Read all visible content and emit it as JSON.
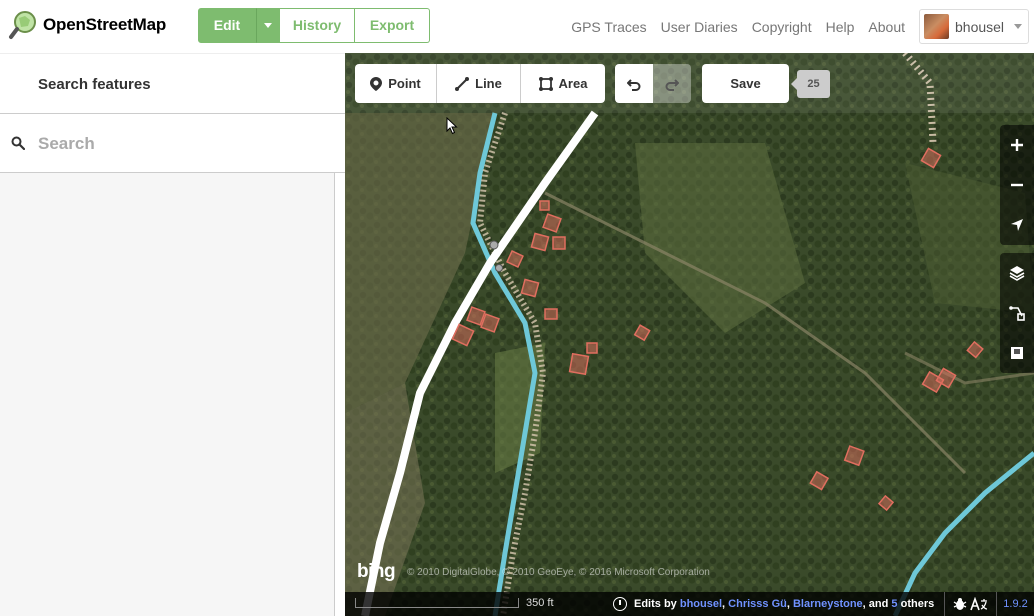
{
  "app": {
    "brand": "OpenStreetMap",
    "edit_label": "Edit",
    "history_label": "History",
    "export_label": "Export"
  },
  "nav": {
    "links": [
      "GPS Traces",
      "User Diaries",
      "Copyright",
      "Help",
      "About"
    ],
    "username": "bhousel"
  },
  "sidebar": {
    "title": "Search features",
    "search_placeholder": "Search"
  },
  "toolbar": {
    "point_label": "Point",
    "line_label": "Line",
    "area_label": "Area",
    "save_label": "Save",
    "edit_count": "25"
  },
  "map": {
    "imagery_logo": "bing",
    "attribution": "© 2010 DigitalGlobe, © 2010 GeoEye, © 2016 Microsoft Corporation",
    "scale_label": "350 ft",
    "footer": {
      "edits_by": "Edits by",
      "users": [
        "bhousel",
        "Chrisss Gü",
        "Blarneystone"
      ],
      "and_text": "and",
      "others_count": "5",
      "others_text": "others"
    },
    "version": "1.9.2",
    "colors": {
      "road_white": "#ffffff",
      "stream_blue": "#6ec8d8",
      "path_tan": "#d8c8b0",
      "building_fill": "#e06e5f",
      "brand_green": "#7ebc6f",
      "link_blue": "#7092ff"
    }
  }
}
